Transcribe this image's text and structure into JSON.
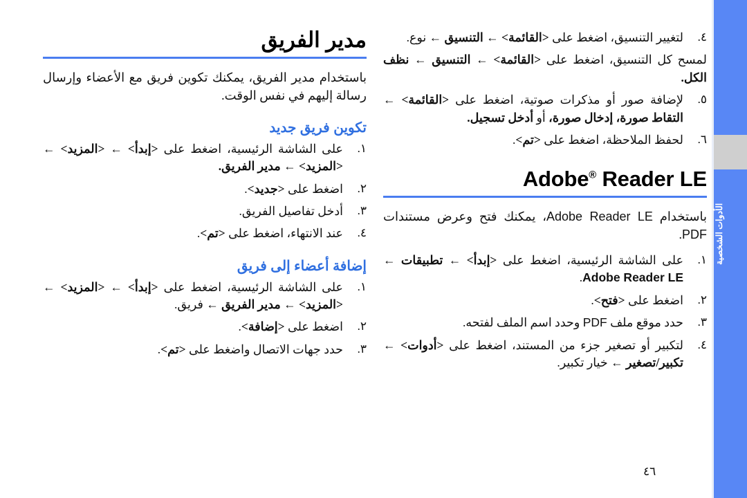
{
  "page": {
    "number": "٤٦",
    "language": "ar",
    "direction": "rtl"
  },
  "edge_tab": {
    "label": "الأدوات الشخصية",
    "color": "#5887f5",
    "gap_color": "#cfcfcf",
    "text_color": "#ffffff"
  },
  "colors": {
    "accent_rule": "#4a7df0",
    "subheading": "#2f6fe0",
    "body_text": "#111111",
    "heading_text": "#000000"
  },
  "right_column": {
    "continued_steps": [
      {
        "marker": "٤.",
        "text": "لتغيير التنسيق، اضغط على <القائمة> ← التنسيق ← نوع."
      },
      {
        "marker": "",
        "text": "لمسح كل التنسيق، اضغط على <القائمة> ← التنسيق ← نظف الكل."
      },
      {
        "marker": "٥.",
        "text": "لإضافة صور أو مذكرات صوتية، اضغط على <القائمة> ← التقاط صورة، إدخال صورة، أو أدخل تسجيل."
      },
      {
        "marker": "٦.",
        "text": "لحفظ الملاحظة، اضغط على <تم>."
      }
    ],
    "section": {
      "title_html": "Adobe<sup>®</sup> Reader LE",
      "title_plain": "Adobe® Reader LE",
      "intro": "باستخدام Adobe Reader LE، يمكنك فتح وعرض مستندات PDF.",
      "steps": [
        {
          "marker": "١.",
          "text": "على الشاشة الرئيسية، اضغط على <إبدأ> ← تطبيقات ← Adobe Reader LE."
        },
        {
          "marker": "٢.",
          "text": "اضغط على <فتح>."
        },
        {
          "marker": "٣.",
          "text": "حدد موقع ملف PDF وحدد اسم الملف لفتحه."
        },
        {
          "marker": "٤.",
          "text": "لتكبير أو تصغير جزء من المستند، اضغط على <أدوات> ← تكبير/تصغير ← خيار تكبير."
        }
      ]
    }
  },
  "left_column": {
    "section": {
      "title": "مدير الفريق",
      "intro": "باستخدام مدير الفريق، يمكنك تكوين فريق مع الأعضاء وإرسال رسالة إليهم في نفس الوقت."
    },
    "subsections": [
      {
        "title": "تكوين فريق جديد",
        "steps": [
          {
            "marker": "١.",
            "text": "على الشاشة الرئيسية، اضغط على <إبدأ> ← <المزيد> ← <المزيد> ← مدير الفريق."
          },
          {
            "marker": "٢.",
            "text": "اضغط على <جديد>."
          },
          {
            "marker": "٣.",
            "text": "أدخل تفاصيل الفريق."
          },
          {
            "marker": "٤.",
            "text": "عند الانتهاء، اضغط على <تم>."
          }
        ]
      },
      {
        "title": "إضافة أعضاء إلى فريق",
        "steps": [
          {
            "marker": "١.",
            "text": "على الشاشة الرئيسية، اضغط على <إبدأ> ← <المزيد> ← <المزيد> ← مدير الفريق ← فريق."
          },
          {
            "marker": "٢.",
            "text": "اضغط على <إضافة>."
          },
          {
            "marker": "٣.",
            "text": "حدد جهات الاتصال واضغط على <تم>."
          }
        ]
      }
    ]
  }
}
